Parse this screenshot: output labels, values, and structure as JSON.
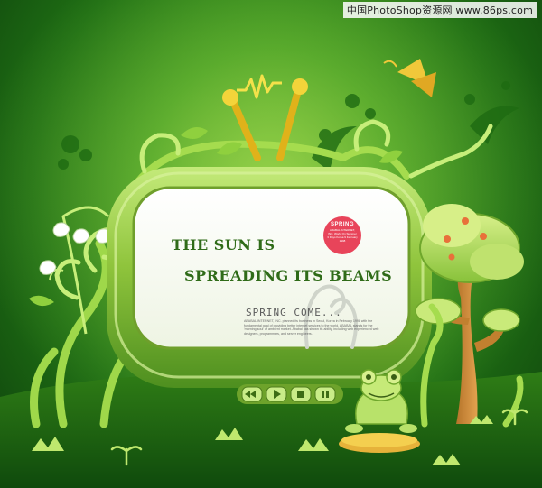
{
  "watermark": "中国PhotoShop资源网 www.86ps.com",
  "screen": {
    "headline_line1": "THE SUN IS",
    "headline_line2": "SPREADING ITS BEAMS",
    "tagline": "SPRING COME...",
    "fine_print": "ABABAL INTERNET, INC. planned its business in Seoul, Korea in February 1998 with the fundamental goal of providing better internet services to the world. ABABAL stands for the 'morning soul' of ambient market. Ababal has shown its ability, including web experienced web designers, programmers, and server engineers."
  },
  "badge": {
    "title": "SPRING",
    "text": "ABABAL INTERNET, INC. World On Summer 3 Days Korea 9 February 1998"
  },
  "controls": [
    "rewind",
    "play",
    "stop",
    "pause"
  ],
  "colors": {
    "background": "#2f8a1a",
    "headline": "#2f6b18",
    "badge": "#e8445a",
    "antenna": "#e0b21a"
  }
}
